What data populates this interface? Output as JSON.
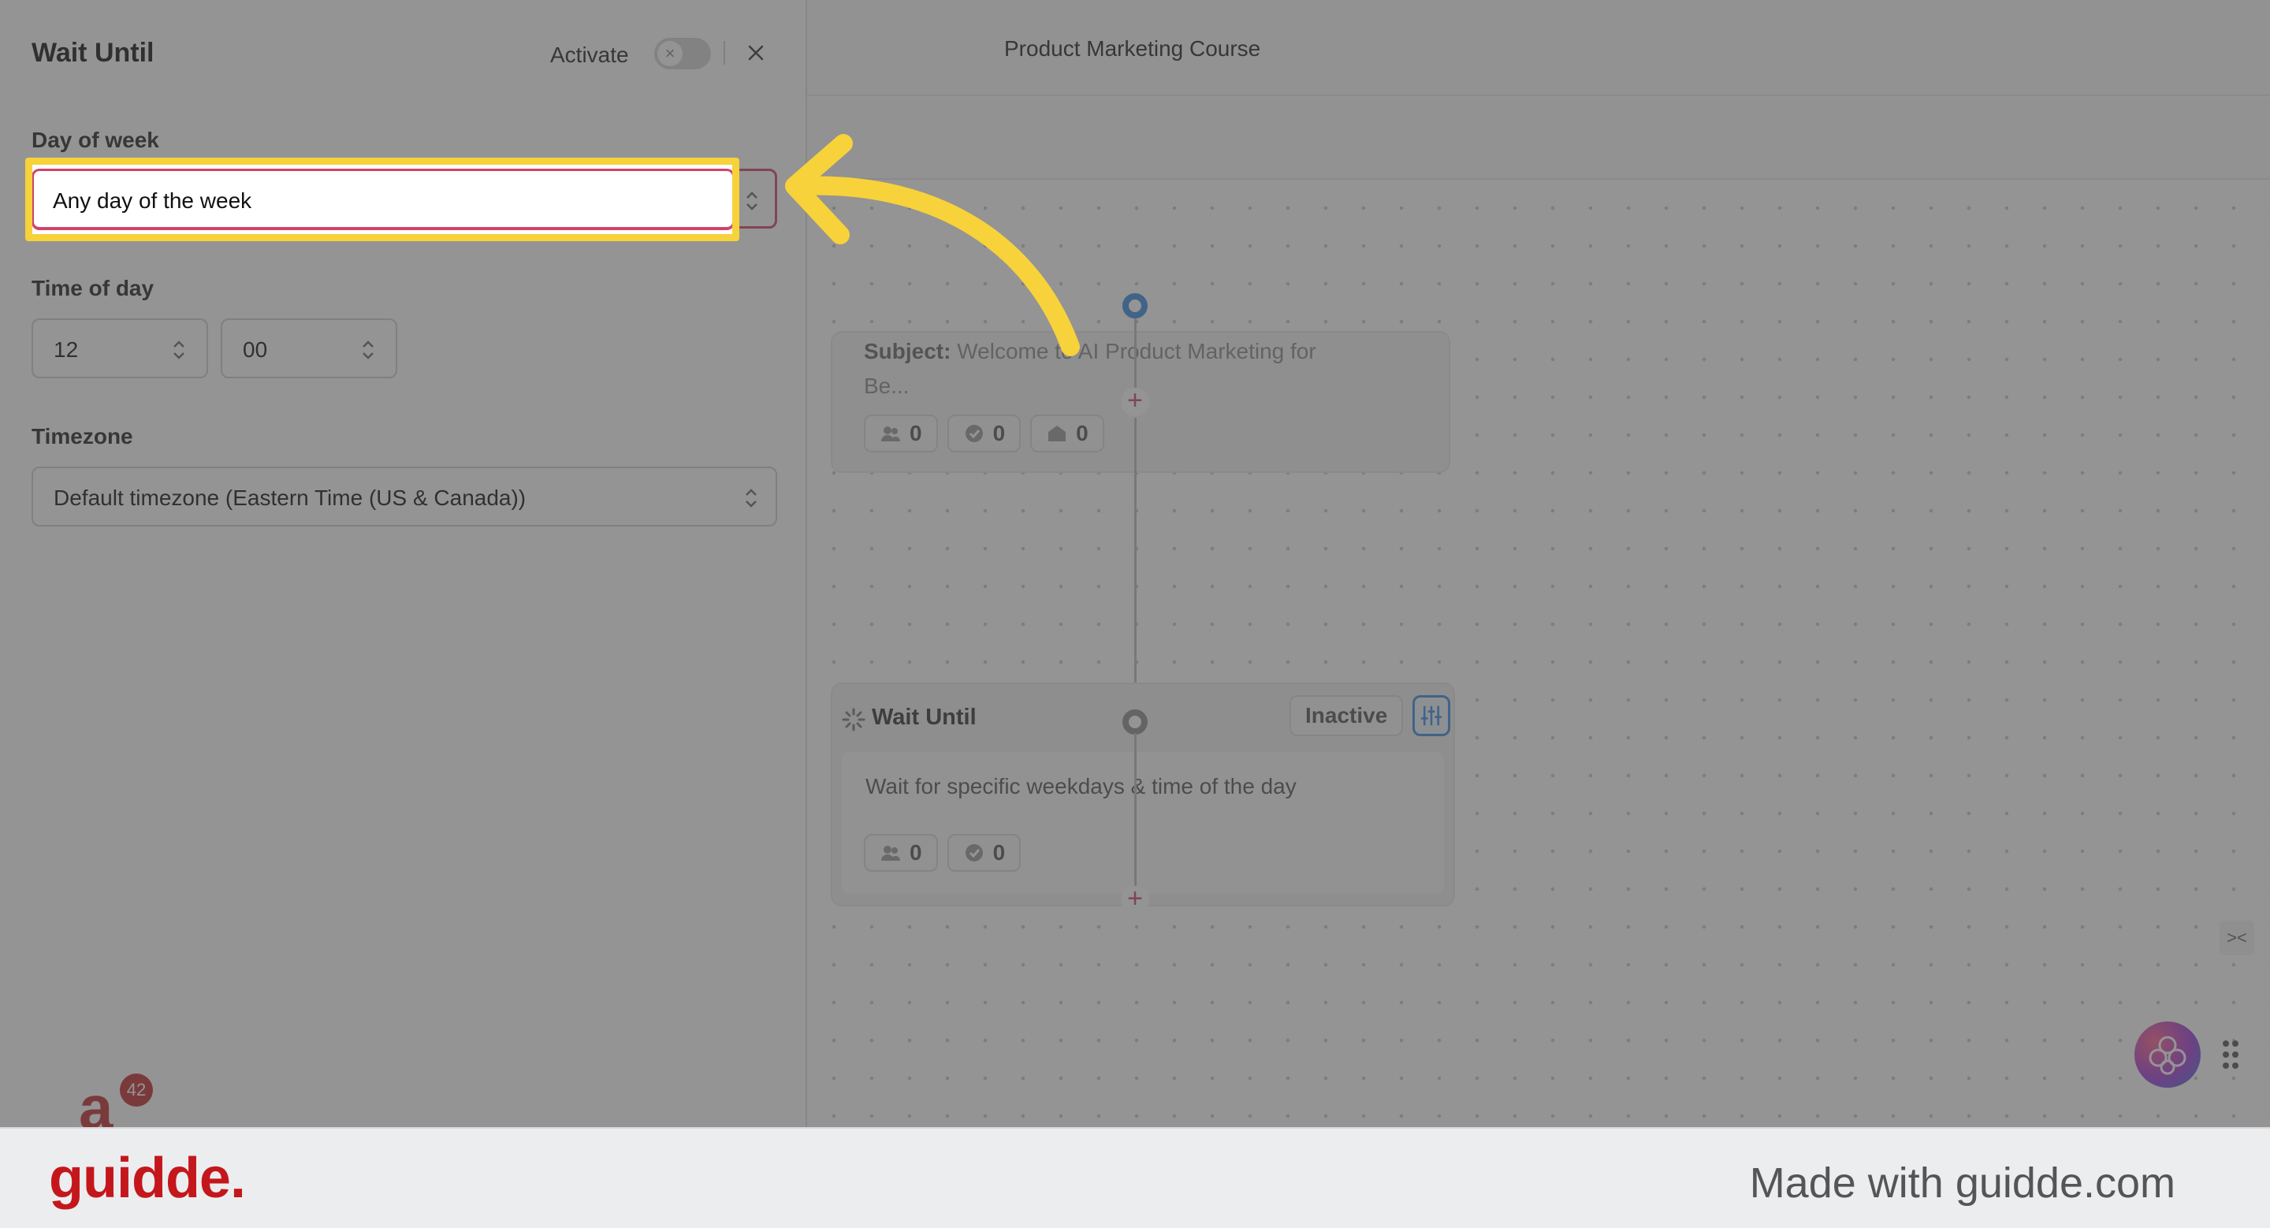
{
  "panel": {
    "title": "Wait Until",
    "activate_label": "Activate",
    "day_of_week_label": "Day of week",
    "day_of_week_value": "Any day of the week",
    "time_of_day_label": "Time of day",
    "hour_value": "12",
    "minute_value": "00",
    "timezone_label": "Timezone",
    "timezone_value": "Default timezone (Eastern Time (US & Canada))",
    "activated": false
  },
  "canvas": {
    "title": "Product Marketing Course",
    "email_node": {
      "subject_label": "Subject:",
      "subject_text": "Welcome to AI Product Marketing for",
      "line2": "Be...",
      "stats": [
        "0",
        "0",
        "0"
      ]
    },
    "wait_node": {
      "title": "Wait Until",
      "status": "Inactive",
      "description": "Wait for specific weekdays & time of the day",
      "stats": [
        "0",
        "0"
      ]
    }
  },
  "app_badge": {
    "count": "42"
  },
  "footer": {
    "logo": "guidde.",
    "tagline": "Made with guidde.com"
  },
  "colors": {
    "highlight": "#f7d23a",
    "accent_pink": "#d0436a",
    "brand_red": "#c4171c",
    "node_blue": "#3a8be2"
  }
}
